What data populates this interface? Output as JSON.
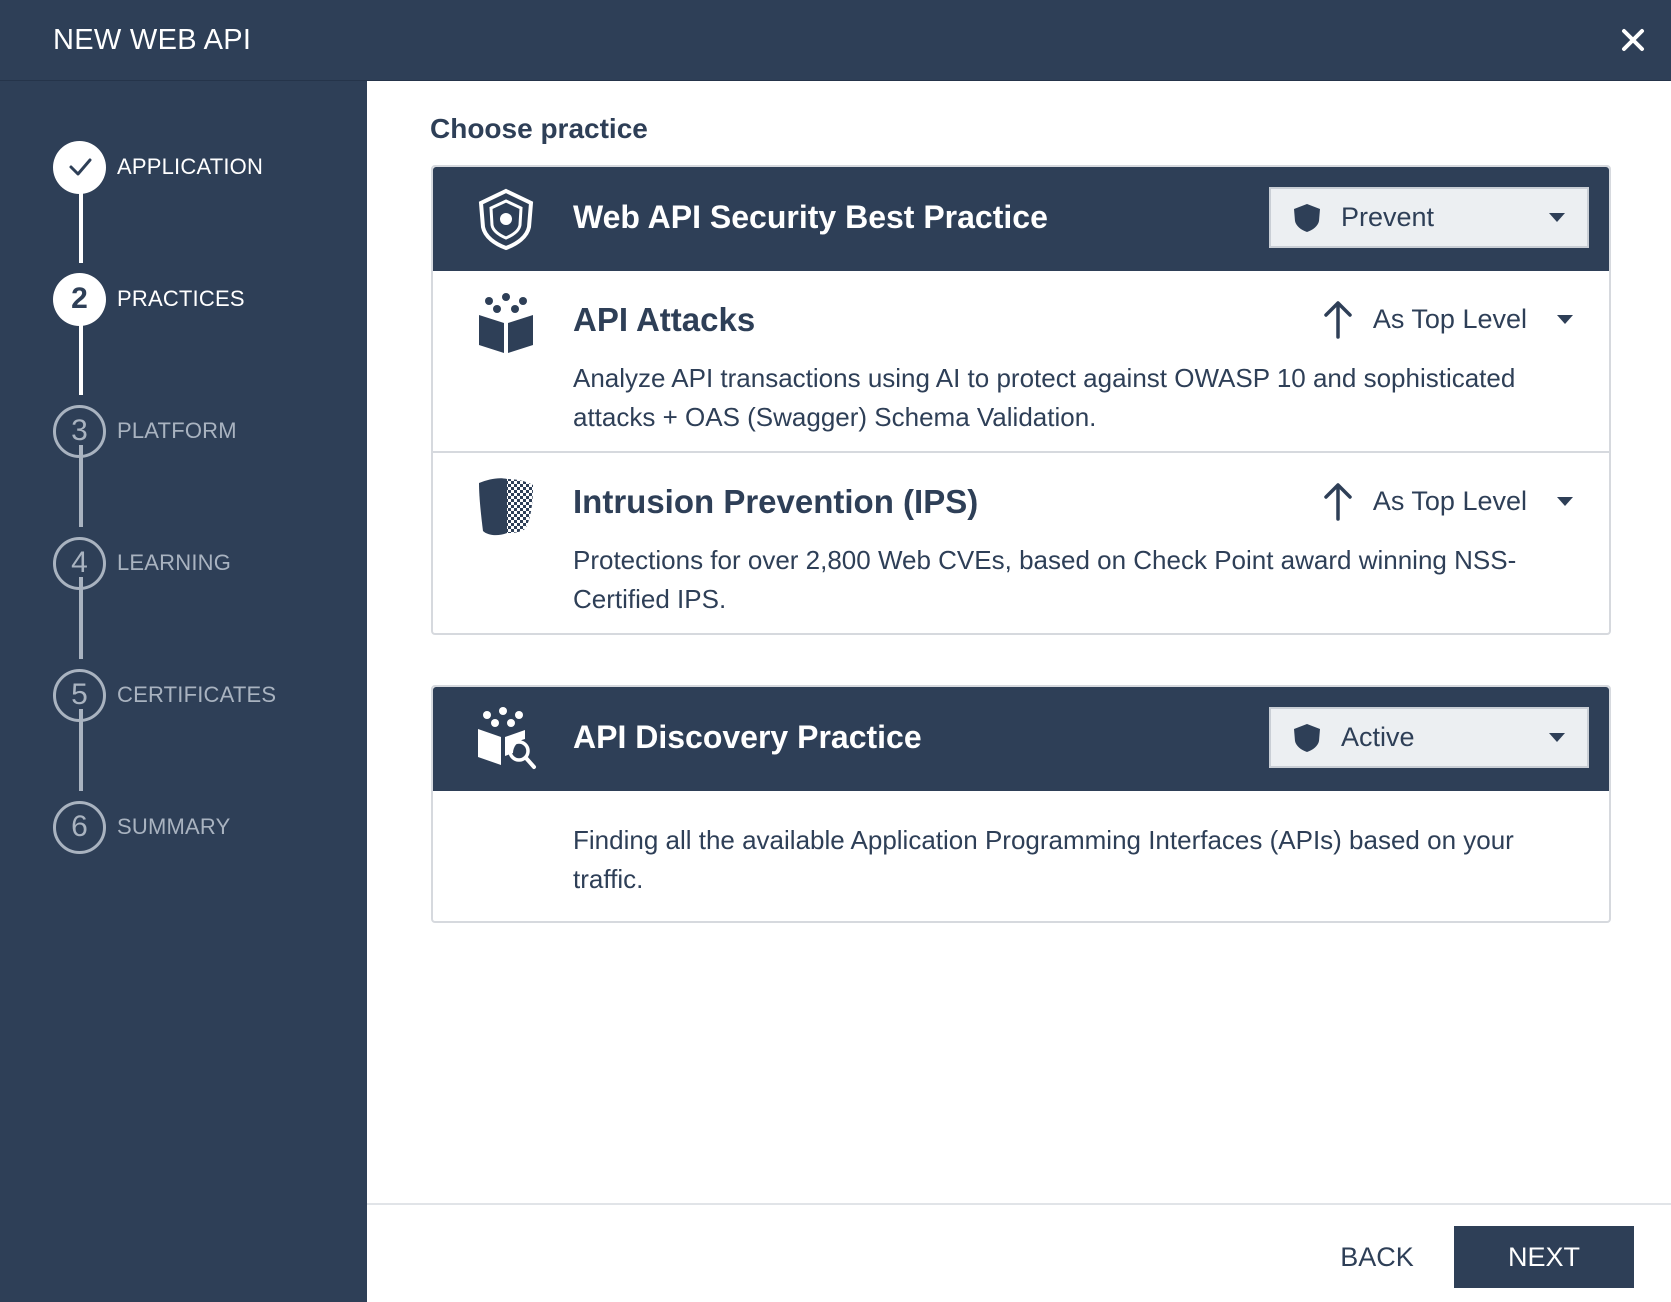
{
  "window": {
    "title": "NEW WEB API",
    "close_icon": "close-icon"
  },
  "steps": [
    {
      "number": "✓",
      "label": "APPLICATION",
      "state": "done"
    },
    {
      "number": "2",
      "label": "PRACTICES",
      "state": "current"
    },
    {
      "number": "3",
      "label": "PLATFORM",
      "state": "todo"
    },
    {
      "number": "4",
      "label": "LEARNING",
      "state": "todo"
    },
    {
      "number": "5",
      "label": "CERTIFICATES",
      "state": "todo"
    },
    {
      "number": "6",
      "label": "SUMMARY",
      "state": "todo"
    }
  ],
  "main": {
    "section_title": "Choose practice",
    "web_api_practice": {
      "title": "Web API Security Best Practice",
      "mode": "Prevent",
      "icon": "shield-target-icon",
      "sub_items": [
        {
          "title": "API Attacks",
          "level": "As Top Level",
          "description": "Analyze API transactions using AI to protect against OWASP 10 and sophisticated attacks + OAS (Swagger) Schema Validation.",
          "icon": "api-cube-icon"
        },
        {
          "title": "Intrusion Prevention (IPS)",
          "level": "As Top Level",
          "description": "Protections for over 2,800 Web CVEs, based on Check Point award winning NSS-Certified IPS.",
          "icon": "ips-shield-icon"
        }
      ]
    },
    "discovery_practice": {
      "title": "API Discovery Practice",
      "mode": "Active",
      "description": "Finding all the available Application Programming Interfaces (APIs) based on your traffic.",
      "icon": "api-discovery-icon"
    }
  },
  "footer": {
    "back_label": "BACK",
    "next_label": "NEXT"
  },
  "colors": {
    "navy": "#2e3f57",
    "muted": "#a9b3c0",
    "white": "#ffffff"
  }
}
